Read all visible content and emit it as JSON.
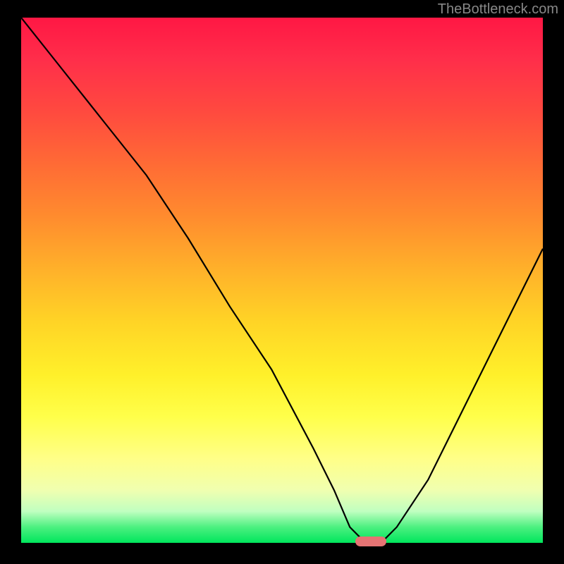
{
  "watermark": "TheBottleneck.com",
  "chart_data": {
    "type": "line",
    "title": "",
    "xlabel": "",
    "ylabel": "",
    "xlim": [
      0,
      100
    ],
    "ylim": [
      0,
      100
    ],
    "grid": false,
    "legend": false,
    "series": [
      {
        "name": "bottleneck-curve",
        "x": [
          0,
          8,
          16,
          24,
          32,
          40,
          48,
          56,
          60,
          63,
          66,
          69,
          72,
          78,
          84,
          90,
          96,
          100
        ],
        "values": [
          100,
          90,
          80,
          70,
          58,
          45,
          33,
          18,
          10,
          3,
          0,
          0,
          3,
          12,
          24,
          36,
          48,
          56
        ]
      }
    ],
    "marker": {
      "name": "optimal-zone",
      "x_center": 67,
      "y": 0,
      "width_pct": 6,
      "color": "#e57373"
    },
    "gradient": {
      "top_color": "#ff1744",
      "mid_color": "#ffd426",
      "bottom_color": "#00e65c"
    }
  }
}
